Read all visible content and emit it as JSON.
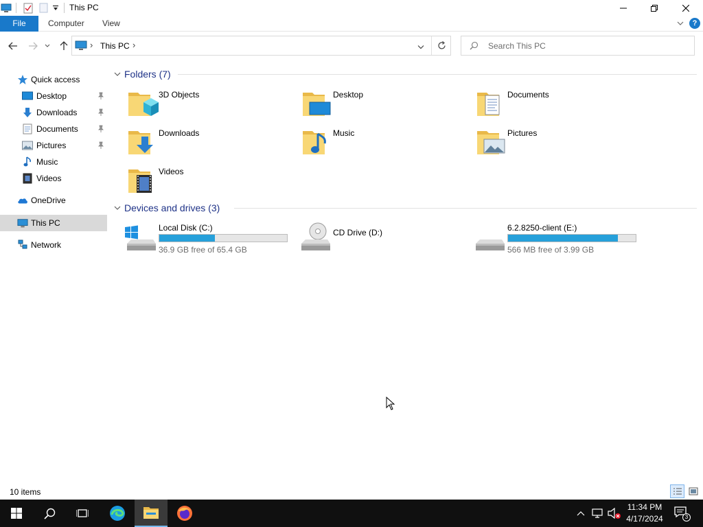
{
  "window": {
    "title": "This PC",
    "controls": {
      "minimize": "minimize",
      "maximize": "restore",
      "close": "close"
    }
  },
  "ribbon": {
    "tabs": [
      {
        "label": "File"
      },
      {
        "label": "Computer"
      },
      {
        "label": "View"
      }
    ],
    "help_icon": "?"
  },
  "address": {
    "breadcrumb": "This PC",
    "separator_glyph": "›",
    "search_placeholder": "Search This PC"
  },
  "nav": {
    "items": [
      {
        "label": "Quick access",
        "icon": "star-icon"
      },
      {
        "label": "Desktop",
        "icon": "desktop-icon",
        "pinned": true
      },
      {
        "label": "Downloads",
        "icon": "downloads-icon",
        "pinned": true
      },
      {
        "label": "Documents",
        "icon": "documents-icon",
        "pinned": true
      },
      {
        "label": "Pictures",
        "icon": "pictures-icon",
        "pinned": true
      },
      {
        "label": "Music",
        "icon": "music-icon",
        "pinned": false
      },
      {
        "label": "Videos",
        "icon": "videos-icon",
        "pinned": false
      },
      {
        "label": "OneDrive",
        "icon": "cloud-icon"
      },
      {
        "label": "This PC",
        "icon": "computer-icon",
        "selected": true
      },
      {
        "label": "Network",
        "icon": "network-icon"
      }
    ]
  },
  "folders": {
    "heading": "Folders (7)",
    "items": [
      {
        "label": "3D Objects",
        "icon": "3d-objects-icon"
      },
      {
        "label": "Desktop",
        "icon": "desktop-folder-icon"
      },
      {
        "label": "Documents",
        "icon": "documents-folder-icon"
      },
      {
        "label": "Downloads",
        "icon": "downloads-folder-icon"
      },
      {
        "label": "Music",
        "icon": "music-folder-icon"
      },
      {
        "label": "Pictures",
        "icon": "pictures-folder-icon"
      },
      {
        "label": "Videos",
        "icon": "videos-folder-icon"
      }
    ]
  },
  "drives": {
    "heading": "Devices and drives (3)",
    "items": [
      {
        "label": "Local Disk (C:)",
        "free": "36.9 GB free of 65.4 GB",
        "used_fraction": 0.436,
        "icon": "windows-drive-icon"
      },
      {
        "label": "CD Drive (D:)",
        "free": "",
        "icon": "cd-drive-icon"
      },
      {
        "label": "6.2.8250-client (E:)",
        "free": "566 MB free of 3.99 GB",
        "used_fraction": 0.861,
        "icon": "usb-drive-icon"
      }
    ]
  },
  "status": {
    "count": "10 items"
  },
  "taskbar": {
    "time": "11:34 PM",
    "date": "4/17/2024",
    "notification_count": "3"
  },
  "colors": {
    "accent": "#1979ca",
    "drive_fill": "#26a0da",
    "folder": "#f8d775",
    "taskbar": "#101010"
  }
}
